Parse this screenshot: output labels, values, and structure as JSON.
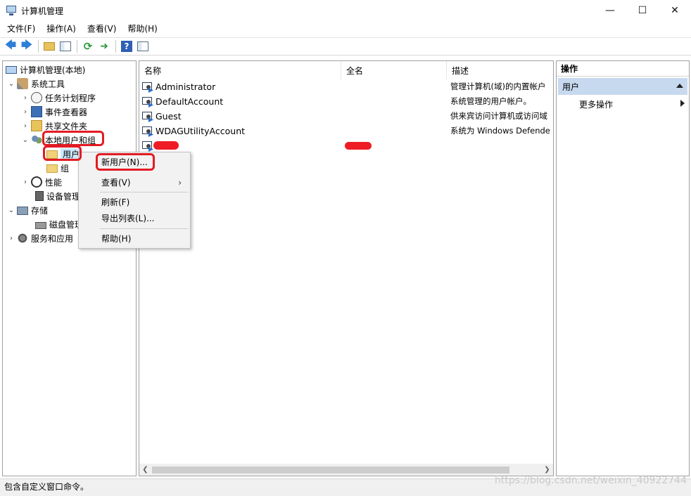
{
  "window": {
    "title": "计算机管理"
  },
  "menubar": {
    "items": [
      "文件(F)",
      "操作(A)",
      "查看(V)",
      "帮助(H)"
    ]
  },
  "tree": {
    "root": "计算机管理(本地)",
    "system_tools": "系统工具",
    "task_scheduler": "任务计划程序",
    "event_viewer": "事件查看器",
    "shared_folders": "共享文件夹",
    "local_users_groups": "本地用户和组",
    "users": "用户",
    "groups": "组",
    "performance": "性能",
    "device_manager": "设备管理",
    "storage": "存储",
    "disk_management": "磁盘管理",
    "services_apps": "服务和应用"
  },
  "list": {
    "columns": {
      "name": "名称",
      "fullname": "全名",
      "description": "描述"
    },
    "rows": [
      {
        "name": "Administrator",
        "fullname": "",
        "description": "管理计算机(域)的内置帐户"
      },
      {
        "name": "DefaultAccount",
        "fullname": "",
        "description": "系统管理的用户帐户。"
      },
      {
        "name": "Guest",
        "fullname": "",
        "description": "供来宾访问计算机或访问域"
      },
      {
        "name": "WDAGUtilityAccount",
        "fullname": "",
        "description": "系统为 Windows Defende"
      }
    ]
  },
  "actions": {
    "title": "操作",
    "section": "用户",
    "more": "更多操作"
  },
  "context_menu": {
    "new_user": "新用户(N)...",
    "view": "查看(V)",
    "refresh": "刷新(F)",
    "export": "导出列表(L)...",
    "help": "帮助(H)"
  },
  "statusbar": {
    "text": "包含自定义窗口命令。"
  },
  "watermark": "https://blog.csdn.net/weixin_40922744",
  "colors": {
    "annotation": "#e31b23",
    "selection": "#cce8ff",
    "action_section": "#c6d9ee"
  }
}
